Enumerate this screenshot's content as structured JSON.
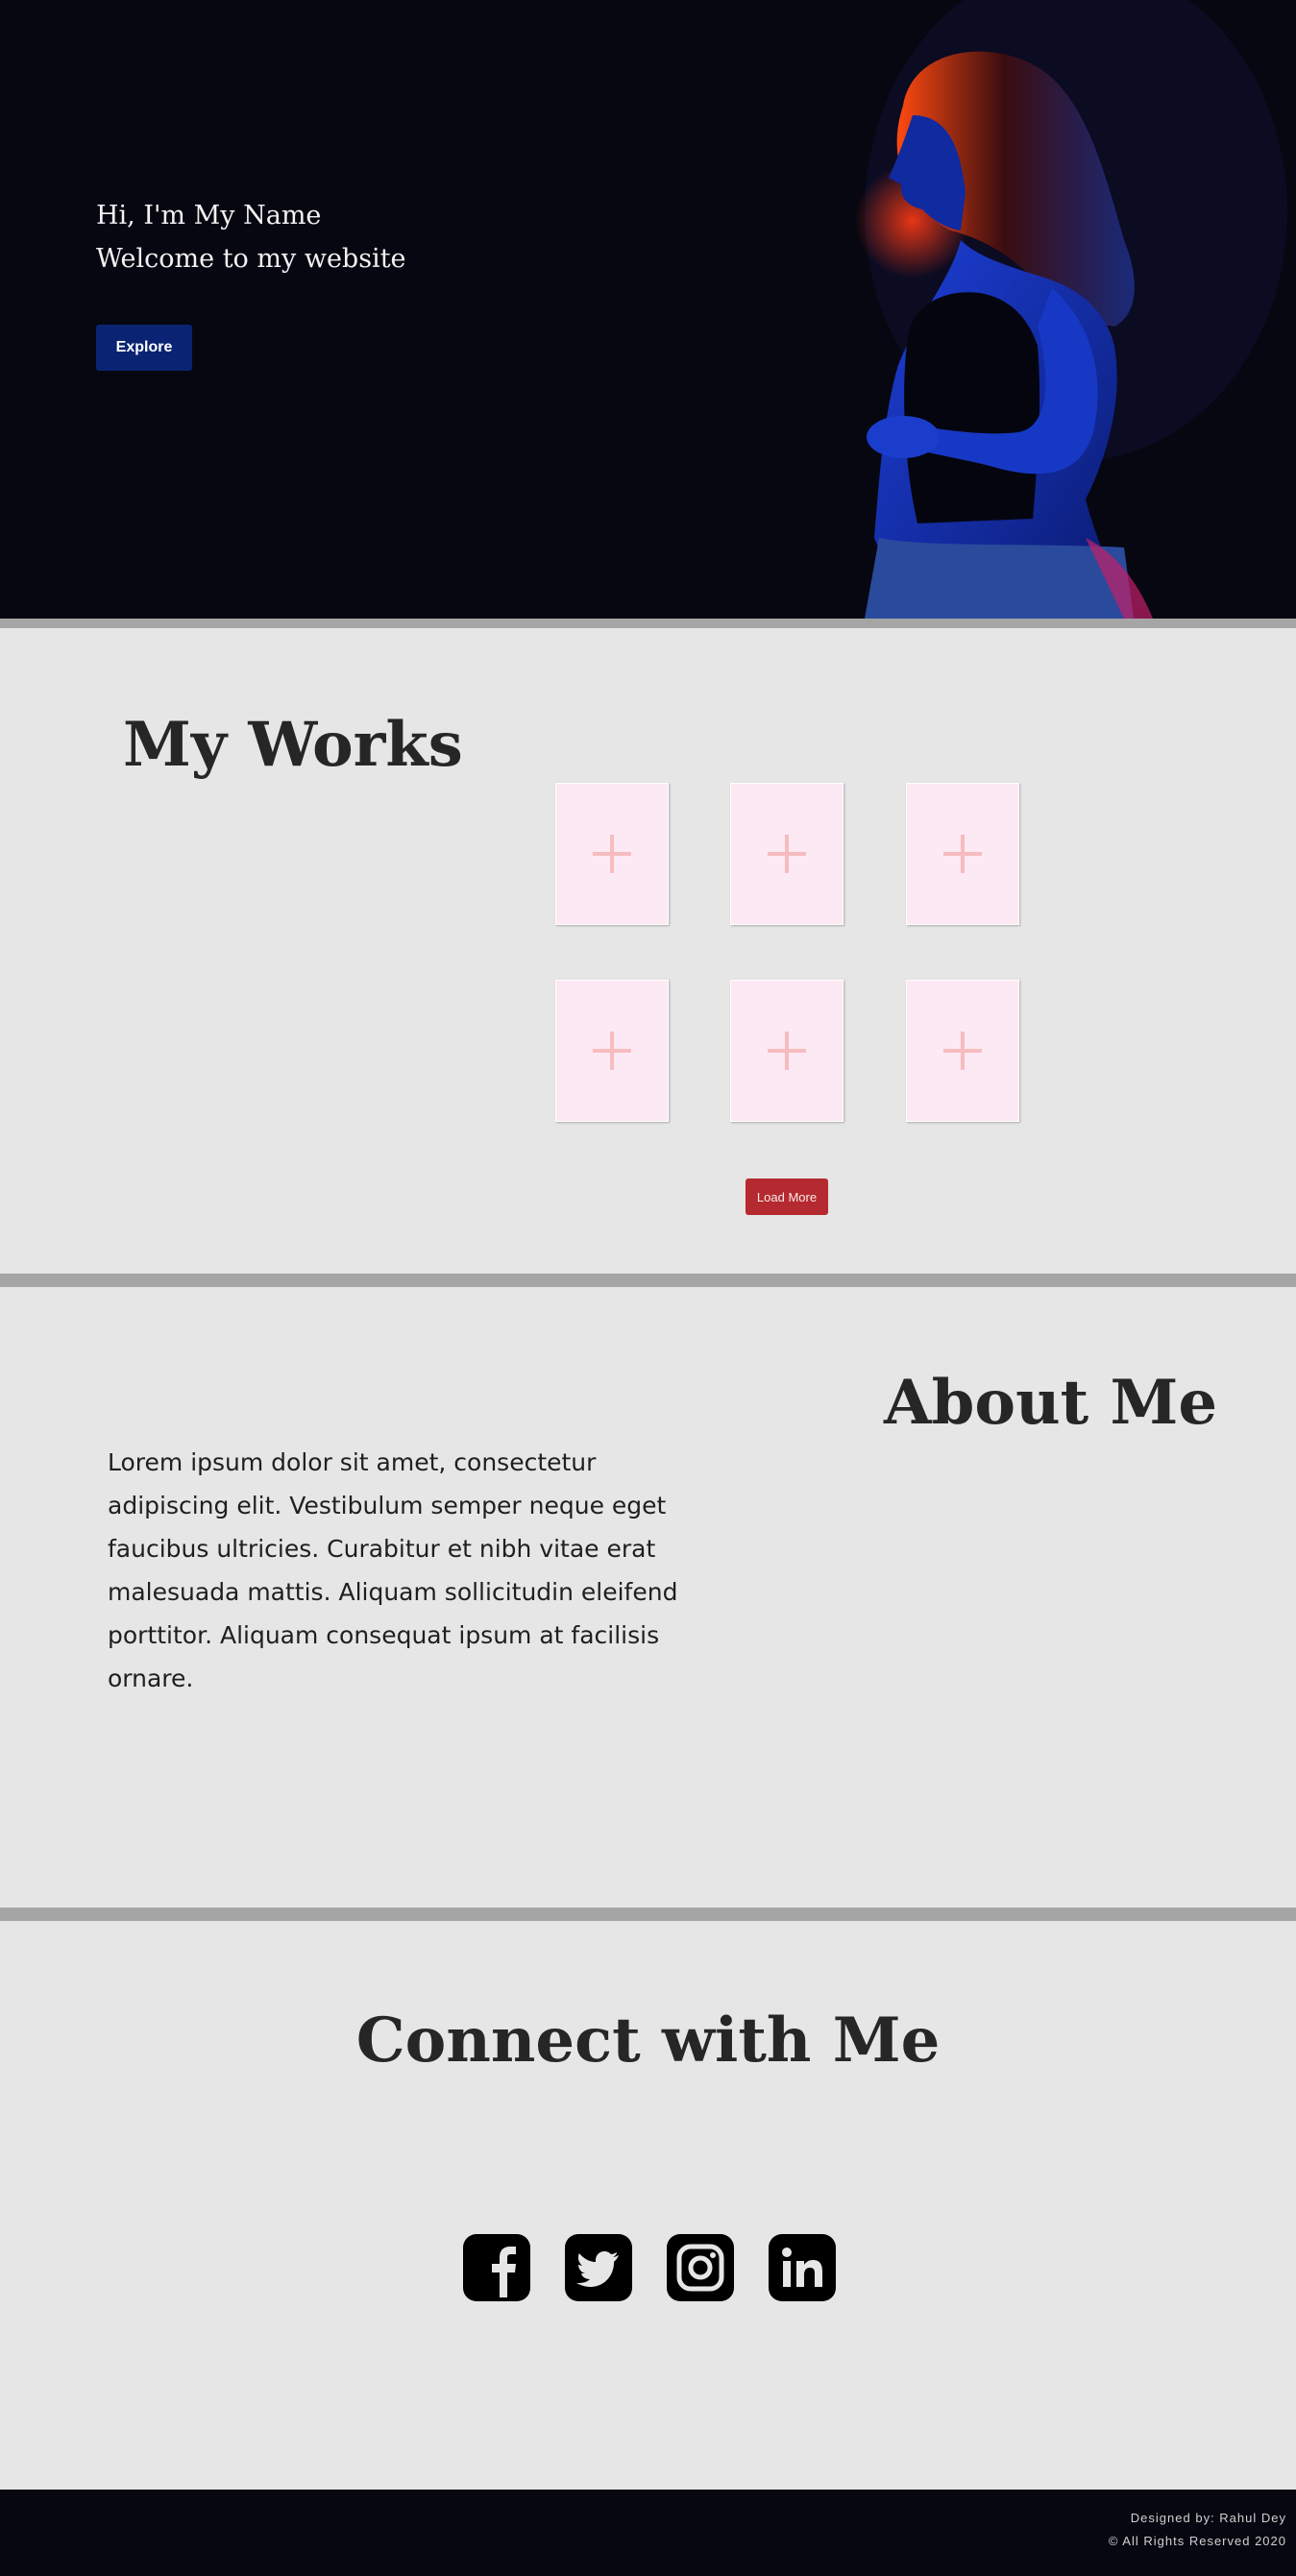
{
  "hero": {
    "greeting": "Hi, I'm My Name",
    "welcome": "Welcome to my website",
    "explore_label": "Explore"
  },
  "works": {
    "title": "My Works",
    "tiles": [
      "add-work",
      "add-work",
      "add-work",
      "add-work",
      "add-work",
      "add-work"
    ],
    "load_more_label": "Load More"
  },
  "about": {
    "title": "About Me",
    "body": "Lorem ipsum dolor sit amet, consectetur adipiscing elit. Vestibulum semper neque eget faucibus ultricies. Curabitur et nibh vitae erat malesuada mattis. Aliquam sollicitudin eleifend porttitor. Aliquam consequat ipsum at facilisis ornare."
  },
  "connect": {
    "title": "Connect with Me",
    "icons": [
      "facebook-icon",
      "twitter-icon",
      "instagram-icon",
      "linkedin-icon"
    ]
  },
  "footer": {
    "designed_by": "Designed by: Rahul Dey",
    "copyright": "© All Rights Reserved 2020"
  },
  "colors": {
    "hero_bg": "#070711",
    "explore_button": "#0a2473",
    "load_more_button": "#b52a30",
    "section_bg": "#e6e6e6",
    "divider": "#a5a5a5",
    "tile_bg": "#fde9f3"
  }
}
